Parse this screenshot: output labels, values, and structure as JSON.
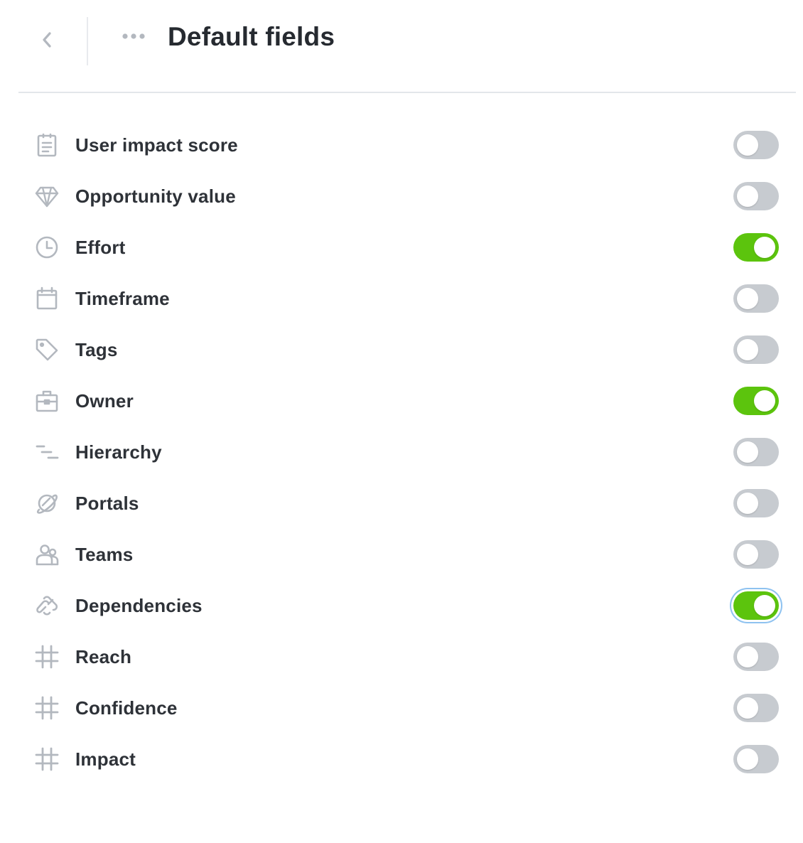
{
  "header": {
    "title": "Default fields",
    "back_icon": "chevron-left-icon",
    "more_icon": "more-horizontal-icon"
  },
  "colors": {
    "toggle_on": "#5cc40d",
    "toggle_off": "#c7cbd0",
    "icon": "#b3b8bf",
    "focus_ring": "#8ec2f0"
  },
  "fields": [
    {
      "label": "User impact score",
      "icon": "clipboard-icon",
      "enabled": false
    },
    {
      "label": "Opportunity value",
      "icon": "diamond-icon",
      "enabled": false
    },
    {
      "label": "Effort",
      "icon": "clock-icon",
      "enabled": true
    },
    {
      "label": "Timeframe",
      "icon": "calendar-icon",
      "enabled": false
    },
    {
      "label": "Tags",
      "icon": "tag-icon",
      "enabled": false
    },
    {
      "label": "Owner",
      "icon": "briefcase-icon",
      "enabled": true
    },
    {
      "label": "Hierarchy",
      "icon": "hierarchy-icon",
      "enabled": false
    },
    {
      "label": "Portals",
      "icon": "planet-icon",
      "enabled": false
    },
    {
      "label": "Teams",
      "icon": "team-icon",
      "enabled": false
    },
    {
      "label": "Dependencies",
      "icon": "link-icon",
      "enabled": true,
      "focused": true
    },
    {
      "label": "Reach",
      "icon": "hash-icon",
      "enabled": false
    },
    {
      "label": "Confidence",
      "icon": "hash-icon",
      "enabled": false
    },
    {
      "label": "Impact",
      "icon": "hash-icon",
      "enabled": false
    }
  ]
}
